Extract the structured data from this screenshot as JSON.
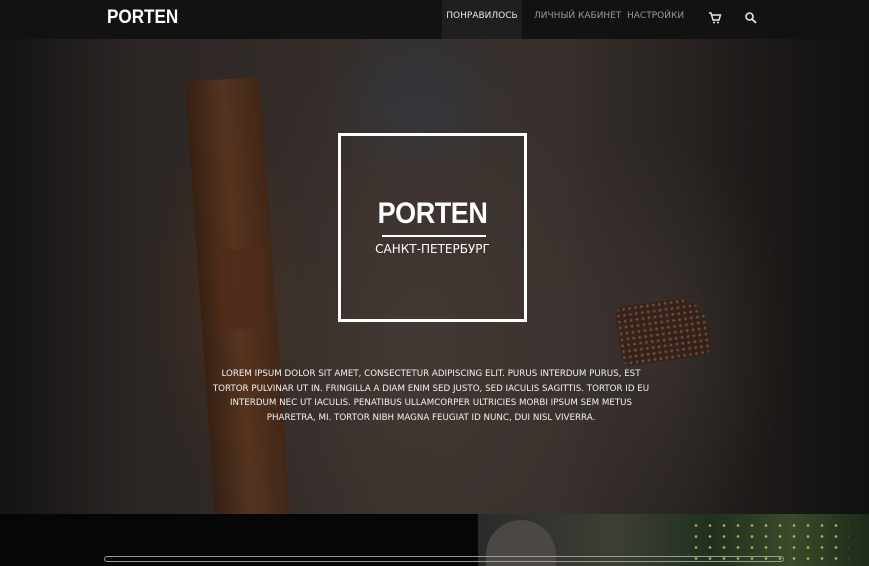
{
  "nav": {
    "logo": "PORTEN",
    "items": [
      {
        "label": "ПОНРАВИЛОСЬ",
        "active": true
      },
      {
        "label": "ЛИЧНЫЙ КАБИНЕТ",
        "active": false
      },
      {
        "label": "НАСТРОЙКИ",
        "active": false
      }
    ],
    "icons": [
      "cart-icon",
      "search-icon"
    ]
  },
  "hero": {
    "brand": "PORTEN",
    "city": "САНКТ-ПЕТЕРБУРГ",
    "blurb": "LOREM IPSUM DOLOR SIT AMET, CONSECTETUR ADIPISCING ELIT. PURUS INTERDUM PURUS, EST TORTOR PULVINAR UT IN. FRINGILLA A DIAM ENIM SED JUSTO, SED IACULIS SAGITTIS. TORTOR ID EU INTERDUM NEC UT IACULIS. PENATIBUS ULLAMCORPER ULTRICIES MORBI IPSUM SEM METUS PHARETRA, MI. TORTOR NIBH MAGNA FEUGIAT ID NUNC, DUI NISL VIVERRA."
  },
  "colors": {
    "nav_bg": "#121212",
    "active_bg": "#1f1f1f",
    "text": "#ffffff"
  }
}
